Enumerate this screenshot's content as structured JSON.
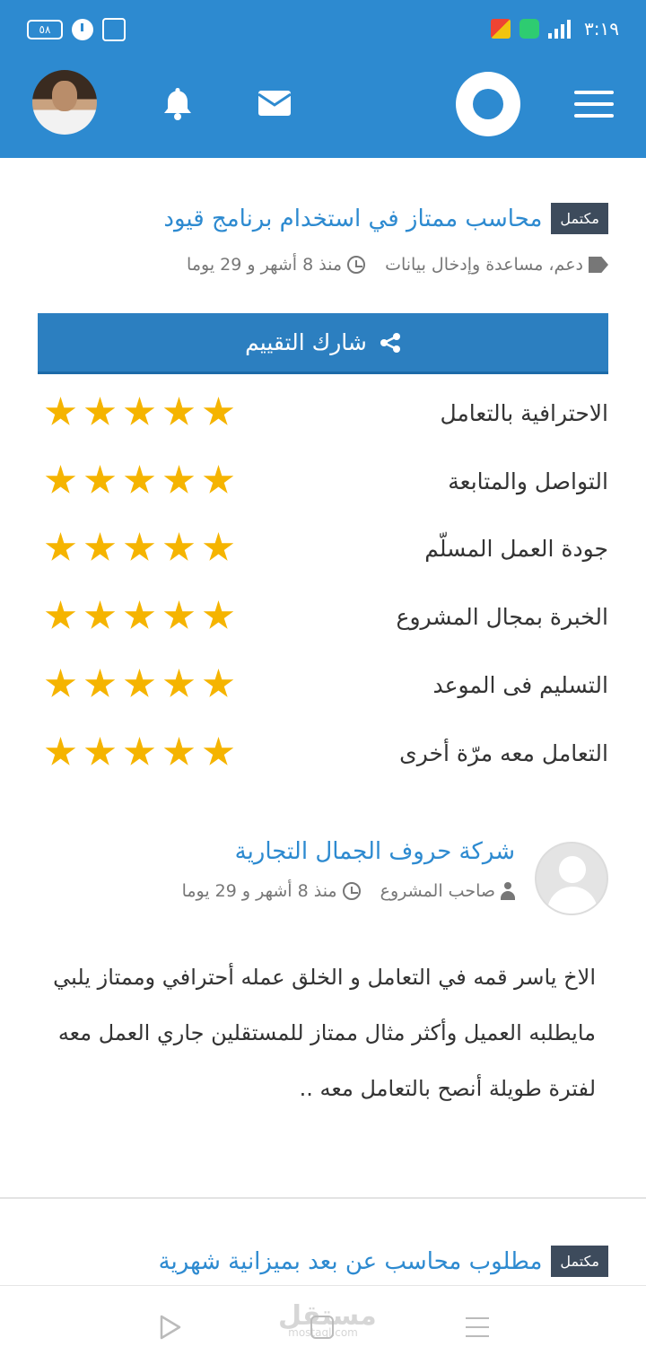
{
  "status_bar": {
    "time": "٣:١٩",
    "battery": "٥٨",
    "signal": "٤G"
  },
  "header": {
    "logo": "mostaql-logo",
    "icons": [
      "avatar",
      "bell-icon",
      "mail-icon",
      "menu-icon"
    ]
  },
  "project": {
    "status_badge": "مكتمل",
    "title": "محاسب ممتاز في استخدام برنامج قيود",
    "tags": "دعم، مساعدة وإدخال بيانات",
    "time_ago": "منذ 8 أشهر و 29 يوما"
  },
  "share_button": {
    "label": "شارك التقييم"
  },
  "ratings": [
    {
      "label": "الاحترافية بالتعامل",
      "stars": 5
    },
    {
      "label": "التواصل والمتابعة",
      "stars": 5
    },
    {
      "label": "جودة العمل المسلّم",
      "stars": 5
    },
    {
      "label": "الخبرة بمجال المشروع",
      "stars": 5
    },
    {
      "label": "التسليم فى الموعد",
      "stars": 5
    },
    {
      "label": "التعامل معه مرّة أخرى",
      "stars": 5
    }
  ],
  "review": {
    "author": "شركة حروف الجمال التجارية",
    "role": "صاحب المشروع",
    "time_ago": "منذ 8 أشهر و 29 يوما",
    "text": "الاخ ياسر قمه في التعامل و الخلق عمله أحترافي وممتاز يلبي مايطلبه العميل وأكثر مثال ممتاز للمستقلين جاري العمل معه لفترة طويلة أنصح بالتعامل معه .."
  },
  "next_project": {
    "status_badge": "مكتمل",
    "title": "مطلوب محاسب عن بعد بميزانية شهرية"
  },
  "bottom_nav": {
    "watermark": "مستقل",
    "watermark_sub": "mostaql.com"
  },
  "colors": {
    "header": "#2d8ad0",
    "link": "#2d8ad0",
    "badge": "#3d4b5c",
    "star": "#f5b400",
    "share_button": "#2c7fc0"
  }
}
